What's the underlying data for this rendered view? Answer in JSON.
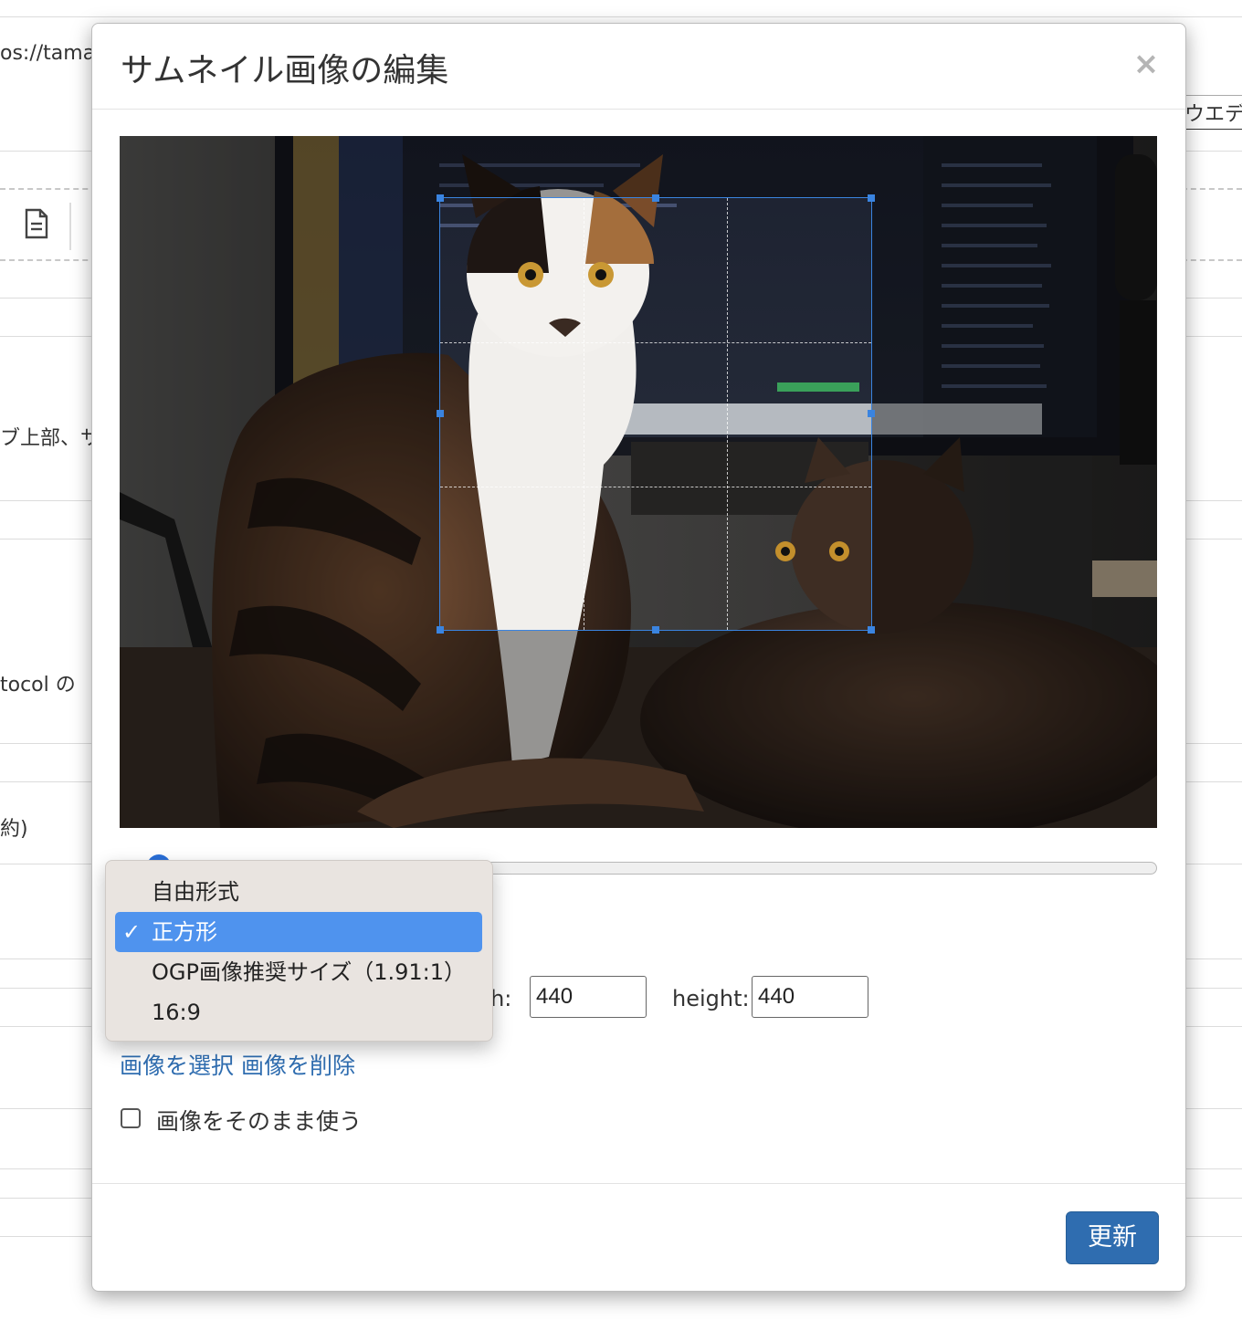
{
  "background": {
    "url_fragment": "os://tama",
    "right_tab_text": "ウエデ",
    "text_1": "ブ上部、サ",
    "text_2": "tocol の",
    "text_3": "約)"
  },
  "modal": {
    "title": "サムネイル画像の編集",
    "close_glyph": "×",
    "width_label": "lth:",
    "width_value": "440",
    "height_label": "height:",
    "height_value": "440",
    "select_image_link": "画像を選択",
    "delete_image_link": "画像を削除",
    "use_as_is_label": "画像をそのまま使う",
    "use_as_is_checked": false,
    "update_button": "更新",
    "zoom_level": 0.03
  },
  "aspect_dropdown": {
    "options": [
      "自由形式",
      "正方形",
      "OGP画像推奨サイズ（1.91:1）",
      "16:9"
    ],
    "selected": "正方形",
    "check_glyph": "✓"
  },
  "colors": {
    "accent": "#2f6db0",
    "selection": "#4f93ee",
    "crop_border": "#3a84e0"
  },
  "icons": [
    "document-icon",
    "close-icon",
    "checkmark-icon"
  ]
}
